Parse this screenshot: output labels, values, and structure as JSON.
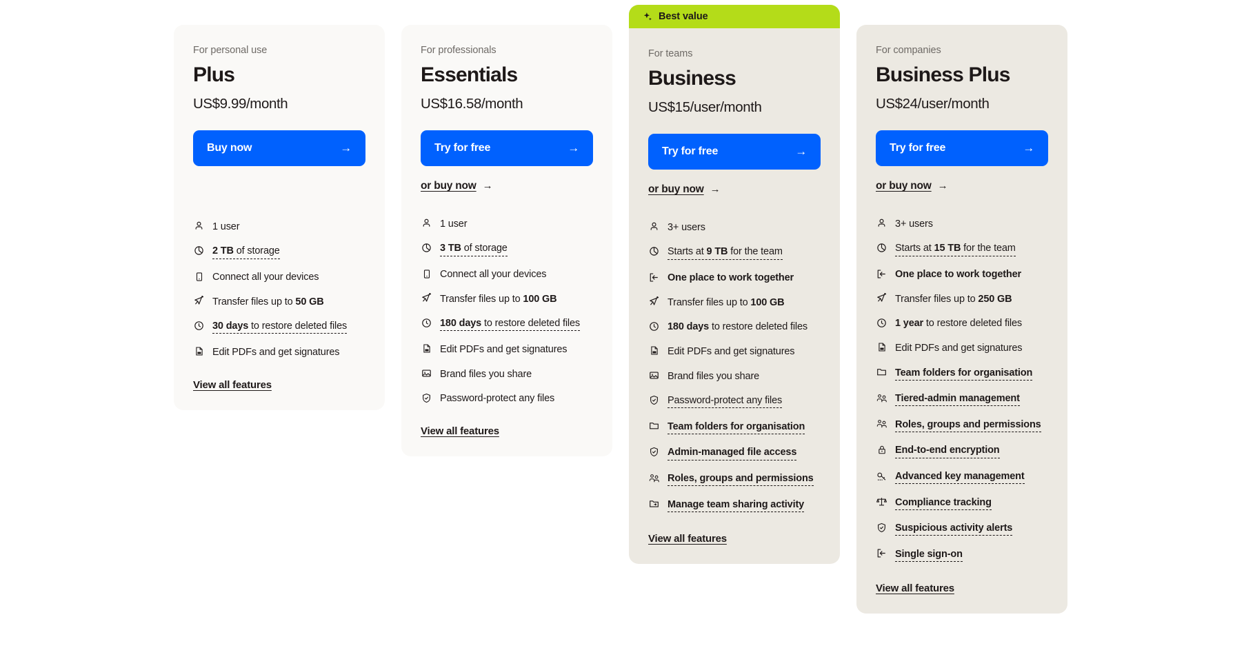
{
  "page": {
    "title": "Dropbox plan comparison pricing cards"
  },
  "icons": {
    "sparkle": "sparkle-icon",
    "user": "user-icon",
    "storage": "pie-chart-storage-icon",
    "device": "mobile-device-icon",
    "transfer": "paper-plane-transfer-icon",
    "restore": "clock-restore-icon",
    "pdf": "pdf-document-icon",
    "brand": "image-branding-icon",
    "shield": "shield-check-icon",
    "folder": "folder-icon",
    "people": "people-admin-icon",
    "lock": "padlock-icon",
    "key": "key-icon",
    "scales": "scales-compliance-icon",
    "signin": "sign-in-arrow-icon",
    "sharing": "folder-share-icon"
  },
  "colors": {
    "accent_blue": "#0061fe",
    "badge_lime": "#b4dc19",
    "card_light": "#faf9f7",
    "card_warm": "#ece9e2",
    "text_primary": "#1e1919",
    "text_muted": "#6e6a66"
  },
  "common": {
    "view_all_features": "View all features",
    "or_buy_now": "or buy now",
    "arrow": "→"
  },
  "plans": [
    {
      "id": "plus",
      "tone": "tone-light",
      "badge": null,
      "eyebrow": "For personal use",
      "name": "Plus",
      "price": "US$9.99/month",
      "cta": "Buy now",
      "secondary": null,
      "features": [
        {
          "icon": "user",
          "text": "1 user",
          "style": "plain"
        },
        {
          "icon": "storage",
          "text": "2 TB of storage",
          "style": "tip",
          "bold_prefix": "2 TB"
        },
        {
          "icon": "device",
          "text": "Connect all your devices",
          "style": "plain"
        },
        {
          "icon": "transfer",
          "text": "Transfer files up to 50 GB",
          "style": "plain",
          "bold_suffix": "50 GB"
        },
        {
          "icon": "restore",
          "text": "30 days to restore deleted files",
          "style": "tip",
          "bold_prefix": "30 days"
        },
        {
          "icon": "pdf",
          "text": "Edit PDFs and get signatures",
          "style": "plain"
        }
      ]
    },
    {
      "id": "essentials",
      "tone": "tone-light",
      "badge": null,
      "eyebrow": "For professionals",
      "name": "Essentials",
      "price": "US$16.58/month",
      "cta": "Try for free",
      "secondary": "or buy now",
      "features": [
        {
          "icon": "user",
          "text": "1 user",
          "style": "plain"
        },
        {
          "icon": "storage",
          "text": "3 TB of storage",
          "style": "tip",
          "bold_prefix": "3 TB"
        },
        {
          "icon": "device",
          "text": "Connect all your devices",
          "style": "plain"
        },
        {
          "icon": "transfer",
          "text": "Transfer files up to 100 GB",
          "style": "plain",
          "bold_suffix": "100 GB"
        },
        {
          "icon": "restore",
          "text": "180 days to restore deleted files",
          "style": "tip",
          "bold_prefix": "180 days"
        },
        {
          "icon": "pdf",
          "text": "Edit PDFs and get signatures",
          "style": "plain"
        },
        {
          "icon": "brand",
          "text": "Brand files you share",
          "style": "plain"
        },
        {
          "icon": "shield",
          "text": "Password-protect any files",
          "style": "plain"
        }
      ]
    },
    {
      "id": "business",
      "tone": "tone-warm",
      "badge": "Best value",
      "eyebrow": "For teams",
      "name": "Business",
      "price": "US$15/user/month",
      "cta": "Try for free",
      "secondary": "or buy now",
      "features": [
        {
          "icon": "user",
          "text": "3+ users",
          "style": "plain"
        },
        {
          "icon": "storage",
          "text": "Starts at 9 TB for the team",
          "style": "tip",
          "bold_mid": "9 TB"
        },
        {
          "icon": "signin",
          "text": "One place to work together",
          "style": "bold"
        },
        {
          "icon": "transfer",
          "text": "Transfer files up to 100 GB",
          "style": "plain",
          "bold_suffix": "100 GB"
        },
        {
          "icon": "restore",
          "text": "180 days to restore deleted files",
          "style": "plain",
          "bold_prefix": "180 days"
        },
        {
          "icon": "pdf",
          "text": "Edit PDFs and get signatures",
          "style": "plain"
        },
        {
          "icon": "brand",
          "text": "Brand files you share",
          "style": "plain"
        },
        {
          "icon": "shield",
          "text": "Password-protect any files",
          "style": "tip"
        },
        {
          "icon": "folder",
          "text": "Team folders for organisation",
          "style": "tip-bold"
        },
        {
          "icon": "shield",
          "text": "Admin-managed file access",
          "style": "tip-bold"
        },
        {
          "icon": "people",
          "text": "Roles, groups and permissions",
          "style": "tip-bold"
        },
        {
          "icon": "sharing",
          "text": "Manage team sharing activity",
          "style": "tip-bold"
        }
      ]
    },
    {
      "id": "business-plus",
      "tone": "tone-warm",
      "badge": null,
      "eyebrow": "For companies",
      "name": "Business Plus",
      "price": "US$24/user/month",
      "cta": "Try for free",
      "secondary": "or buy now",
      "features": [
        {
          "icon": "user",
          "text": "3+ users",
          "style": "plain"
        },
        {
          "icon": "storage",
          "text": "Starts at 15 TB for the team",
          "style": "tip",
          "bold_mid": "15 TB"
        },
        {
          "icon": "signin",
          "text": "One place to work together",
          "style": "bold"
        },
        {
          "icon": "transfer",
          "text": "Transfer files up to 250 GB",
          "style": "plain",
          "bold_suffix": "250 GB"
        },
        {
          "icon": "restore",
          "text": "1 year to restore deleted files",
          "style": "plain",
          "bold_prefix": "1 year"
        },
        {
          "icon": "pdf",
          "text": "Edit PDFs and get signatures",
          "style": "plain"
        },
        {
          "icon": "folder",
          "text": "Team folders for organisation",
          "style": "tip-bold"
        },
        {
          "icon": "people",
          "text": "Tiered-admin management",
          "style": "tip-bold"
        },
        {
          "icon": "people",
          "text": "Roles, groups and permissions",
          "style": "tip-bold"
        },
        {
          "icon": "lock",
          "text": "End-to-end encryption",
          "style": "tip-bold"
        },
        {
          "icon": "key",
          "text": "Advanced key management",
          "style": "tip-bold"
        },
        {
          "icon": "scales",
          "text": "Compliance tracking",
          "style": "tip-bold"
        },
        {
          "icon": "shield",
          "text": "Suspicious activity alerts",
          "style": "tip-bold"
        },
        {
          "icon": "signin",
          "text": "Single sign-on",
          "style": "tip-bold"
        }
      ]
    }
  ]
}
